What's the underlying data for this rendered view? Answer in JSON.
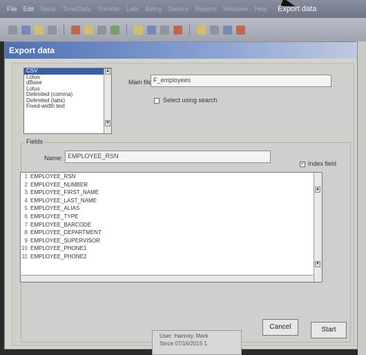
{
  "menu": {
    "items": [
      "File",
      "Edit",
      "Setup",
      "Time/Data",
      "Transfer",
      "Lists",
      "Billing",
      "Service",
      "Reports",
      "Windows",
      "Help"
    ],
    "active": "Export data"
  },
  "dialog": {
    "title": "Export data",
    "formats": [
      "CSV",
      "Lotus",
      "dBase",
      "Lotus",
      "Delimited (comma)",
      "Delimited (tabs)",
      "Fixed-width text"
    ],
    "selected_format": "CSV",
    "main_file_label": "Main file:",
    "main_file_value": "F_employees",
    "select_search_label": "Select using search",
    "fields_group_label": "Fields",
    "name_label": "Name:",
    "name_value": "EMPLOYEE_RSN",
    "index_field_label": "Index field",
    "index_field_checked": true,
    "field_list": [
      {
        "num": "1",
        "name": "EMPLOYEE_RSN"
      },
      {
        "num": "2",
        "name": "EMPLOYEE_NUMBER"
      },
      {
        "num": "3",
        "name": "EMPLOYEE_FIRST_NAME"
      },
      {
        "num": "4",
        "name": "EMPLOYEE_LAST_NAME"
      },
      {
        "num": "5",
        "name": "EMPLOYEE_ALIAS"
      },
      {
        "num": "6",
        "name": "EMPLOYEE_TYPE"
      },
      {
        "num": "7",
        "name": "EMPLOYEE_BARCODE"
      },
      {
        "num": "8",
        "name": "EMPLOYEE_DEPARTMENT"
      },
      {
        "num": "9",
        "name": "EMPLOYEE_SUPERVISOR"
      },
      {
        "num": "10",
        "name": "EMPLOYEE_PHONE1"
      },
      {
        "num": "11",
        "name": "EMPLOYEE_PHONE2"
      }
    ],
    "cancel_label": "Cancel",
    "start_label": "Start"
  },
  "status": {
    "user": "User: Hanney, Mark",
    "date": "Since 07/16/2015 1"
  }
}
